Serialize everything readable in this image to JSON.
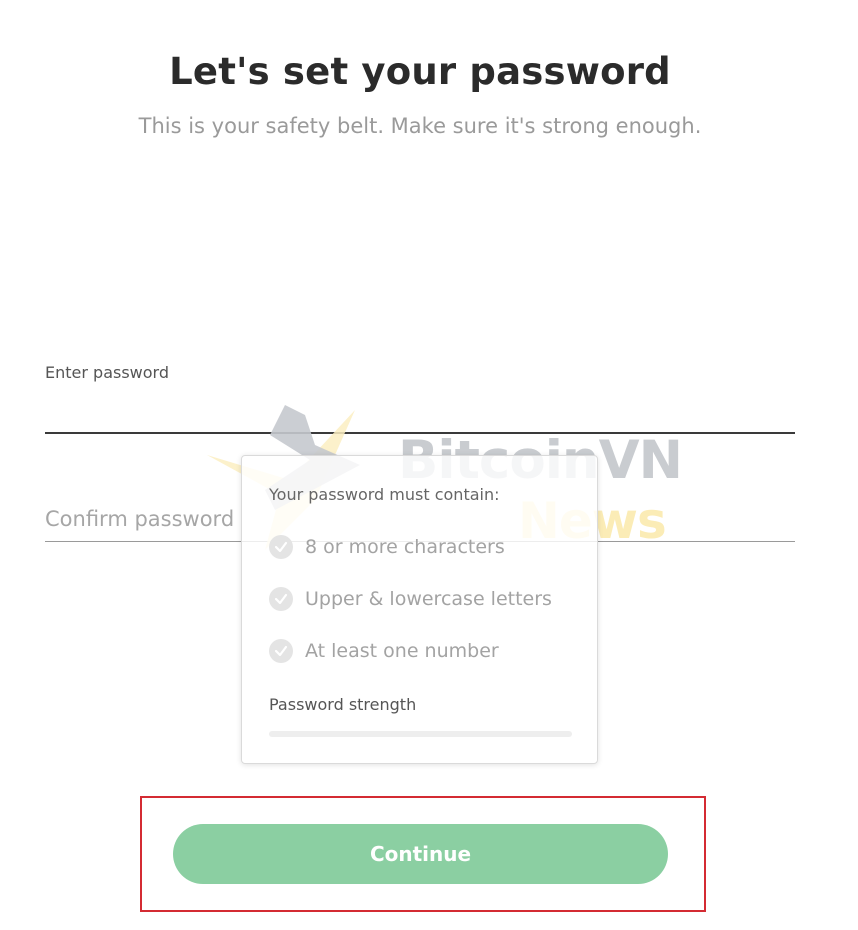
{
  "header": {
    "title": "Let's set your password",
    "subtitle": "This is your safety belt. Make sure it's strong enough."
  },
  "form": {
    "password_label": "Enter password",
    "password_value": "",
    "confirm_placeholder": "Confirm password",
    "confirm_value": ""
  },
  "requirements": {
    "heading": "Your password must contain:",
    "items": [
      {
        "label": "8 or more characters",
        "icon": "check-circle-icon",
        "met": false
      },
      {
        "label": "Upper & lowercase letters",
        "icon": "check-circle-icon",
        "met": false
      },
      {
        "label": "At least one number",
        "icon": "check-circle-icon",
        "met": false
      }
    ],
    "strength_label": "Password strength",
    "strength_fraction": 0
  },
  "actions": {
    "continue_label": "Continue"
  },
  "watermark": {
    "line1": "BitcoinVN",
    "line2": "News"
  },
  "colors": {
    "accent": "#8bcfa2",
    "highlight": "#d42b33",
    "unmet_check": "#e4e4e4"
  }
}
